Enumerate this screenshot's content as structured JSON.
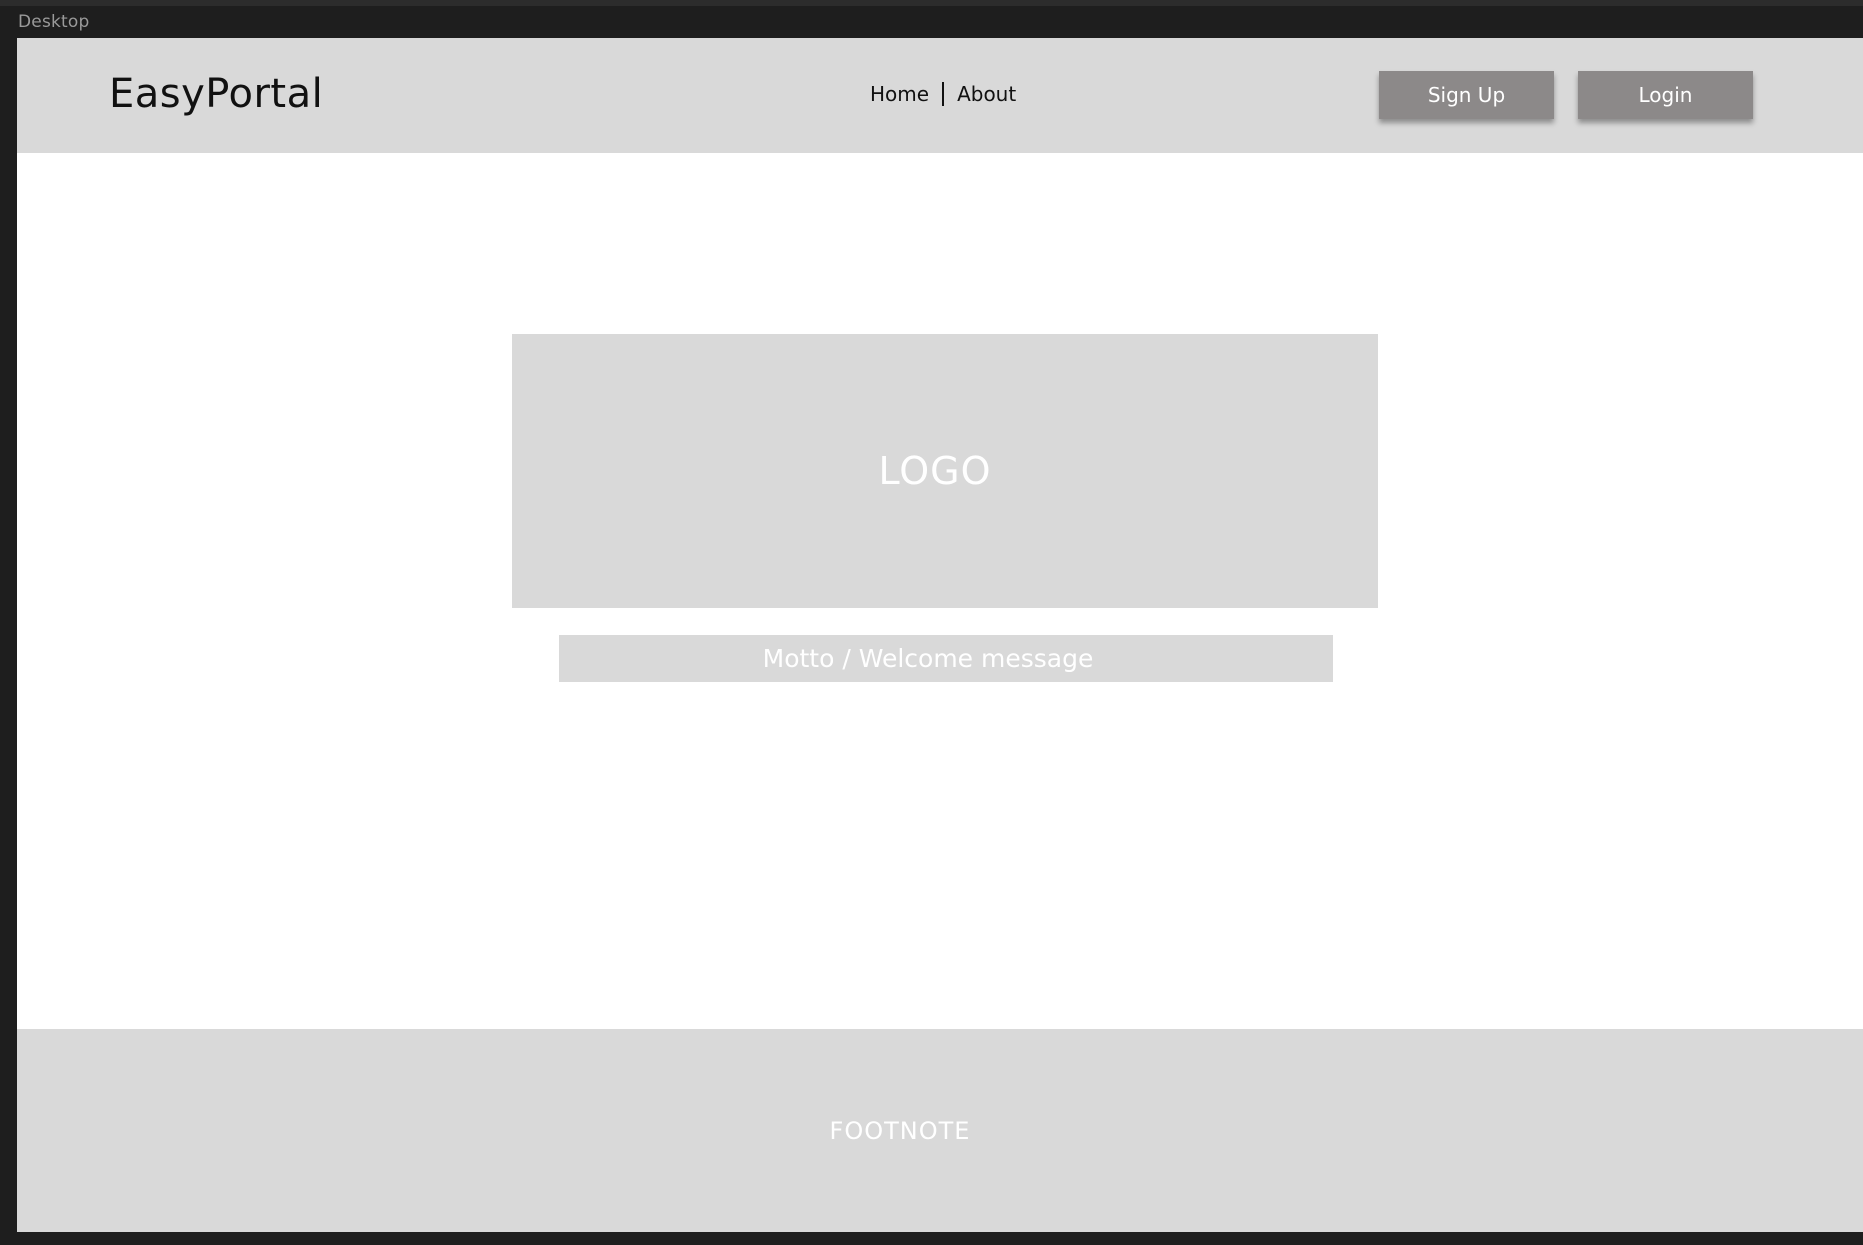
{
  "canvas": {
    "frame_label": "Desktop"
  },
  "header": {
    "site_title": "EasyPortal",
    "nav": [
      {
        "label": "Home"
      },
      {
        "label": "About"
      }
    ],
    "signup_label": "Sign Up",
    "login_label": "Login"
  },
  "hero": {
    "logo_text": "LOGO",
    "motto_text": "Motto / Welcome message"
  },
  "footer": {
    "text": "FOOTNOTE"
  },
  "colors": {
    "canvas_bg": "#1e1e1e",
    "placeholder_gray": "#d9d9d9",
    "button_gray": "#8c8989",
    "frame_bg": "#ffffff"
  }
}
